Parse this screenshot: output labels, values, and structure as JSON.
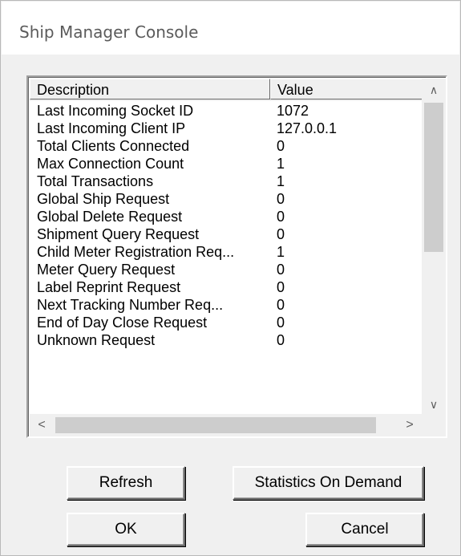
{
  "window": {
    "title": "Ship Manager Console"
  },
  "list": {
    "columns": {
      "description": "Description",
      "value": "Value"
    },
    "rows": [
      {
        "description": "Last Incoming Socket ID",
        "value": "1072"
      },
      {
        "description": "Last Incoming Client IP",
        "value": "127.0.0.1"
      },
      {
        "description": "Total Clients Connected",
        "value": "0"
      },
      {
        "description": "Max Connection Count",
        "value": "1"
      },
      {
        "description": "Total Transactions",
        "value": "1"
      },
      {
        "description": "Global Ship Request",
        "value": "0"
      },
      {
        "description": "Global Delete Request",
        "value": "0"
      },
      {
        "description": "Shipment Query Request",
        "value": "0"
      },
      {
        "description": "Child Meter Registration Req...",
        "value": "1"
      },
      {
        "description": "Meter Query Request",
        "value": "0"
      },
      {
        "description": "Label Reprint Request",
        "value": "0"
      },
      {
        "description": "Next Tracking Number Req...",
        "value": "0"
      },
      {
        "description": "End of Day Close Request",
        "value": "0"
      },
      {
        "description": "Unknown Request",
        "value": "0"
      }
    ]
  },
  "scrollbars": {
    "up_arrow": "∧",
    "down_arrow": "∨",
    "left_arrow": "<",
    "right_arrow": ">"
  },
  "buttons": {
    "refresh": "Refresh",
    "statistics": "Statistics On Demand",
    "ok": "OK",
    "cancel": "Cancel"
  }
}
